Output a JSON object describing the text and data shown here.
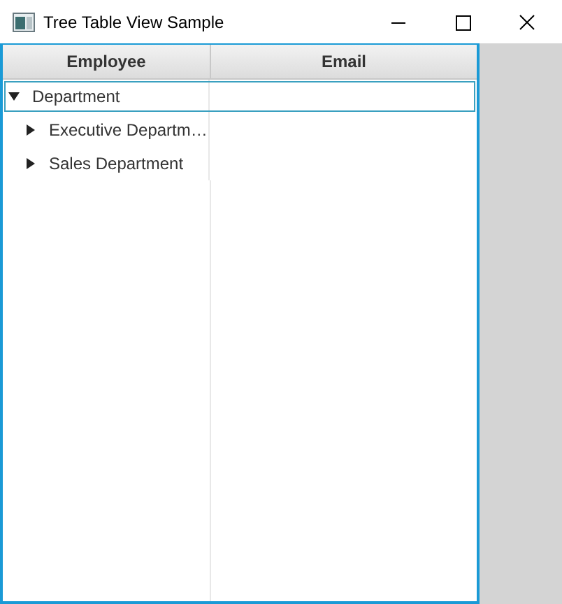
{
  "window": {
    "title": "Tree Table View Sample"
  },
  "table": {
    "columns": [
      "Employee",
      "Email"
    ],
    "rows": [
      {
        "label": "Department",
        "expanded": true,
        "selected": true,
        "children": [
          {
            "label": "Executive Departm…",
            "expanded": false,
            "selected": false
          },
          {
            "label": "Sales Department",
            "expanded": false,
            "selected": false
          }
        ]
      }
    ]
  }
}
